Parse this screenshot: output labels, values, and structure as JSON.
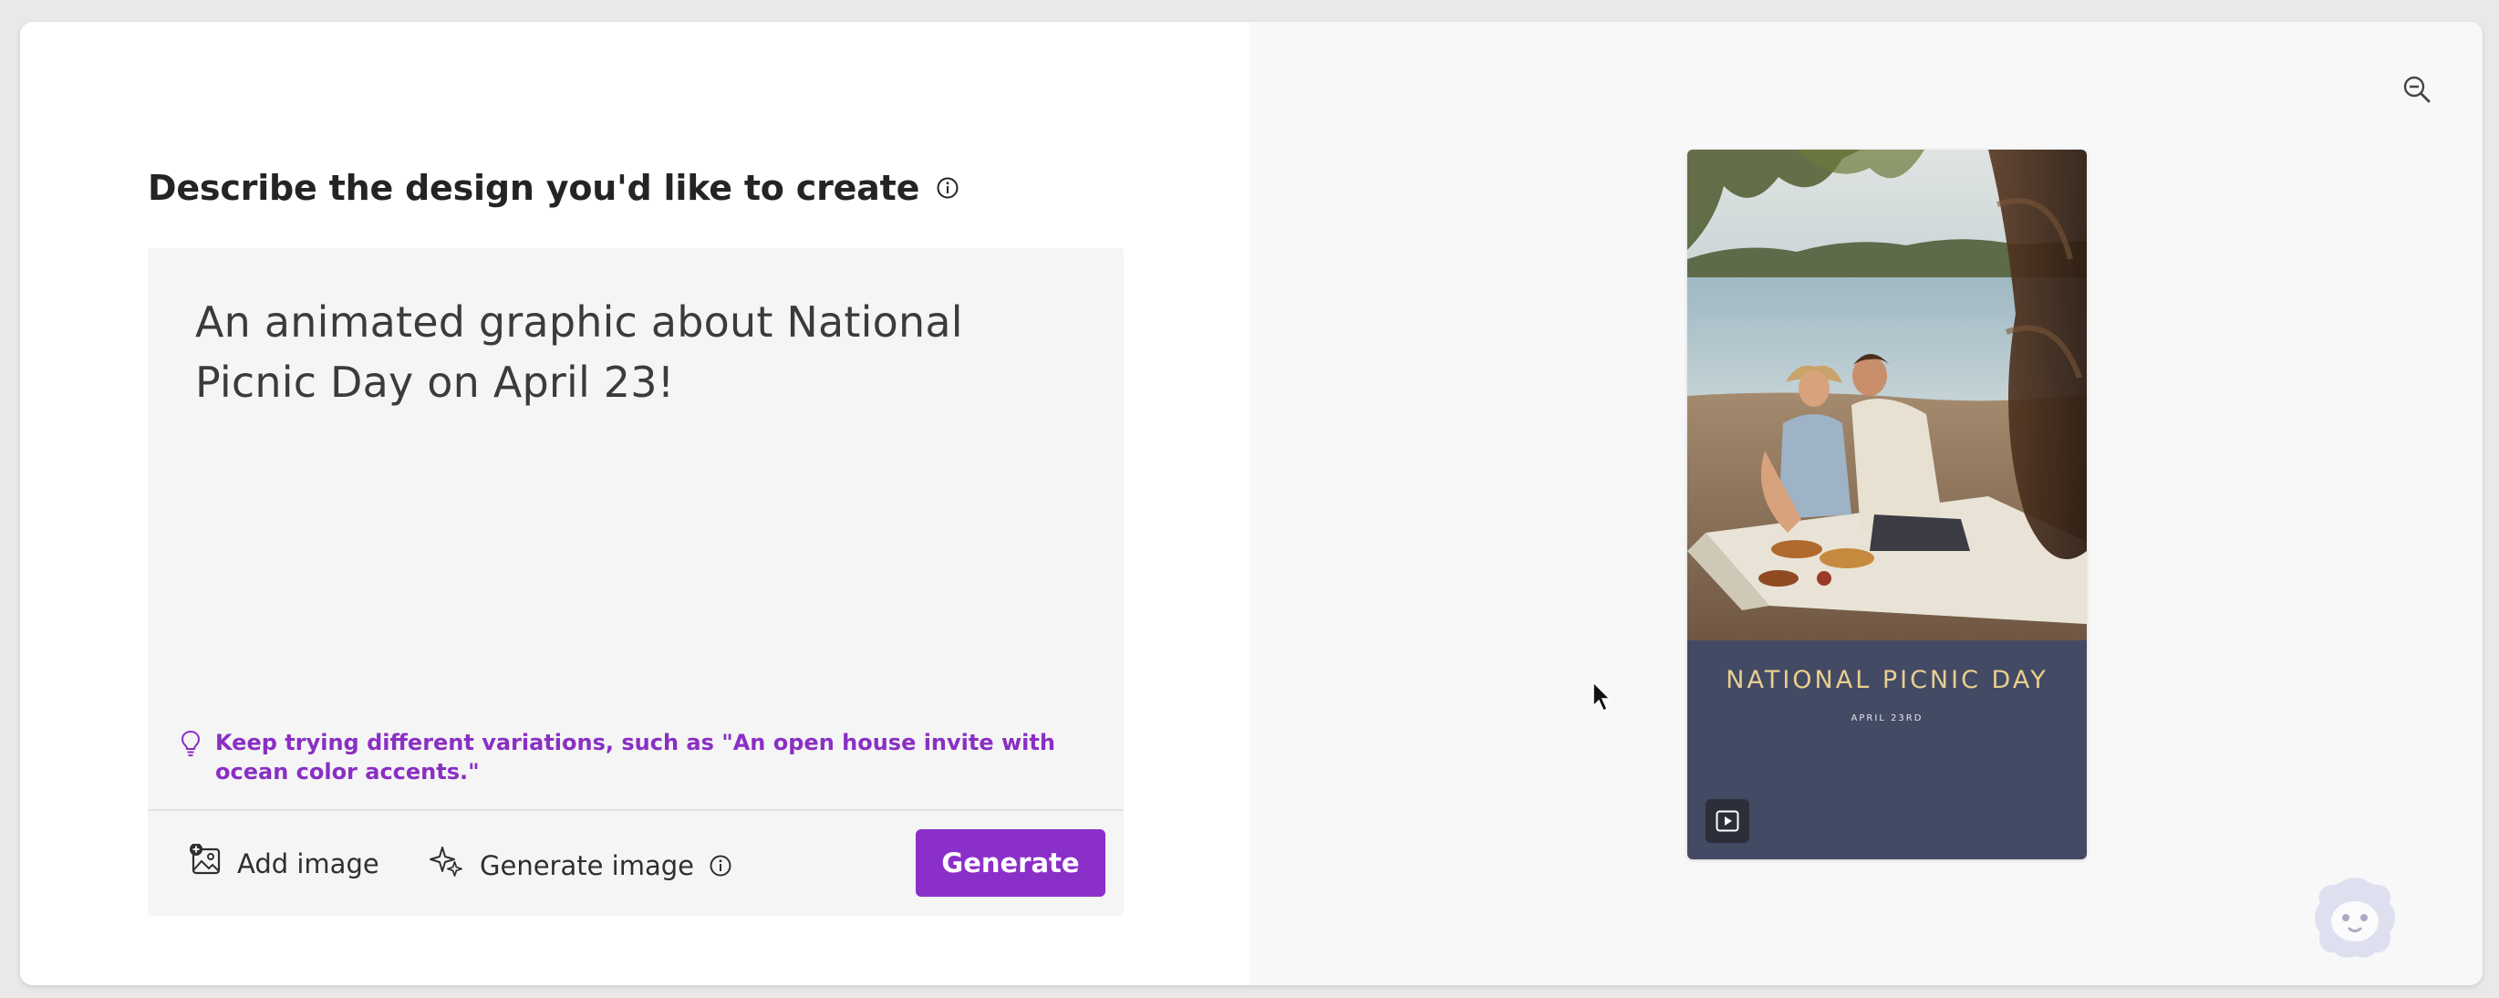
{
  "left": {
    "heading": "Describe the design you'd like to create",
    "prompt_value": "An animated graphic about National Picnic Day on April 23!",
    "tip": "Keep trying different variations, such as \"An open house invite with ocean color accents.\"",
    "add_image_label": "Add image",
    "generate_image_label": "Generate image",
    "generate_button_label": "Generate"
  },
  "preview": {
    "title": "NATIONAL PICNIC DAY",
    "date": "APRIL 23RD",
    "photo_description_icon": "picnic-photo",
    "play_icon": "play-icon"
  },
  "icons": {
    "heading_info": "info-icon",
    "tip": "lightbulb-icon",
    "add_image": "add-image-icon",
    "generate_image": "sparkle-icon",
    "generate_image_info": "info-icon",
    "zoom_out": "zoom-out-icon"
  },
  "colors": {
    "accent": "#8b2fc9",
    "tip_text": "#8a2fc4",
    "poster_bg": "#434a64",
    "poster_title": "#e9cf8e"
  }
}
